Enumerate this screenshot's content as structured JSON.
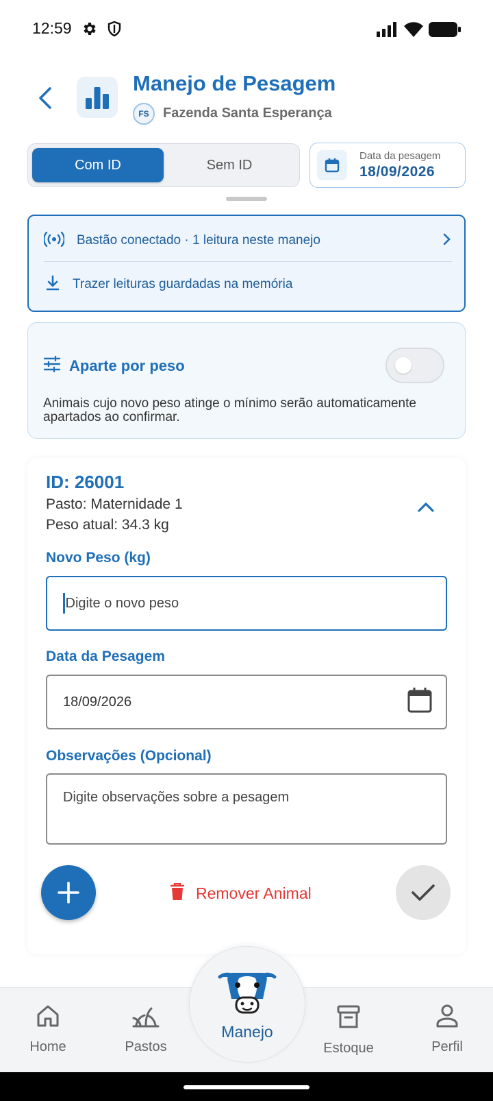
{
  "status_bar": {
    "time": "12:59"
  },
  "header": {
    "title": "Manejo de Pesagem",
    "farm_initials": "FS",
    "farm_name": "Fazenda Santa Esperança"
  },
  "mode_toggle": {
    "options": [
      "Com ID",
      "Sem ID"
    ],
    "selected": "Com ID"
  },
  "date_chip": {
    "label": "Data da pesagem",
    "value": "18/09/2026"
  },
  "bastao": {
    "status": "Bastão conectado · 1 leitura neste manejo",
    "memory_action": "Trazer leituras guardadas na memória"
  },
  "aparte": {
    "title": "Aparte por peso",
    "enabled": false,
    "description": "Animais cujo novo peso atinge o mínimo serão automaticamente apartados ao confirmar."
  },
  "animal": {
    "id_label": "ID: 26001",
    "pasto": "Pasto: Maternidade 1",
    "peso_atual": "Peso atual: 34.3 kg",
    "novo_peso_label": "Novo Peso (kg)",
    "novo_peso_placeholder": "Digite o novo peso",
    "data_label": "Data da Pesagem",
    "data_value": "18/09/2026",
    "obs_label": "Observações (Opcional)",
    "obs_placeholder": "Digite observações sobre a pesagem",
    "remove_label": "Remover Animal"
  },
  "bottom_nav": {
    "items": [
      {
        "label": "Home",
        "icon": "home-icon"
      },
      {
        "label": "Pastos",
        "icon": "grass-icon"
      },
      {
        "label": "Manejo",
        "icon": "cow-icon"
      },
      {
        "label": "Estoque",
        "icon": "archive-icon"
      },
      {
        "label": "Perfil",
        "icon": "person-icon"
      }
    ],
    "active": "Manejo"
  },
  "colors": {
    "primary": "#1f6fb8",
    "danger": "#e53935",
    "card_bg": "#eef5fc"
  }
}
